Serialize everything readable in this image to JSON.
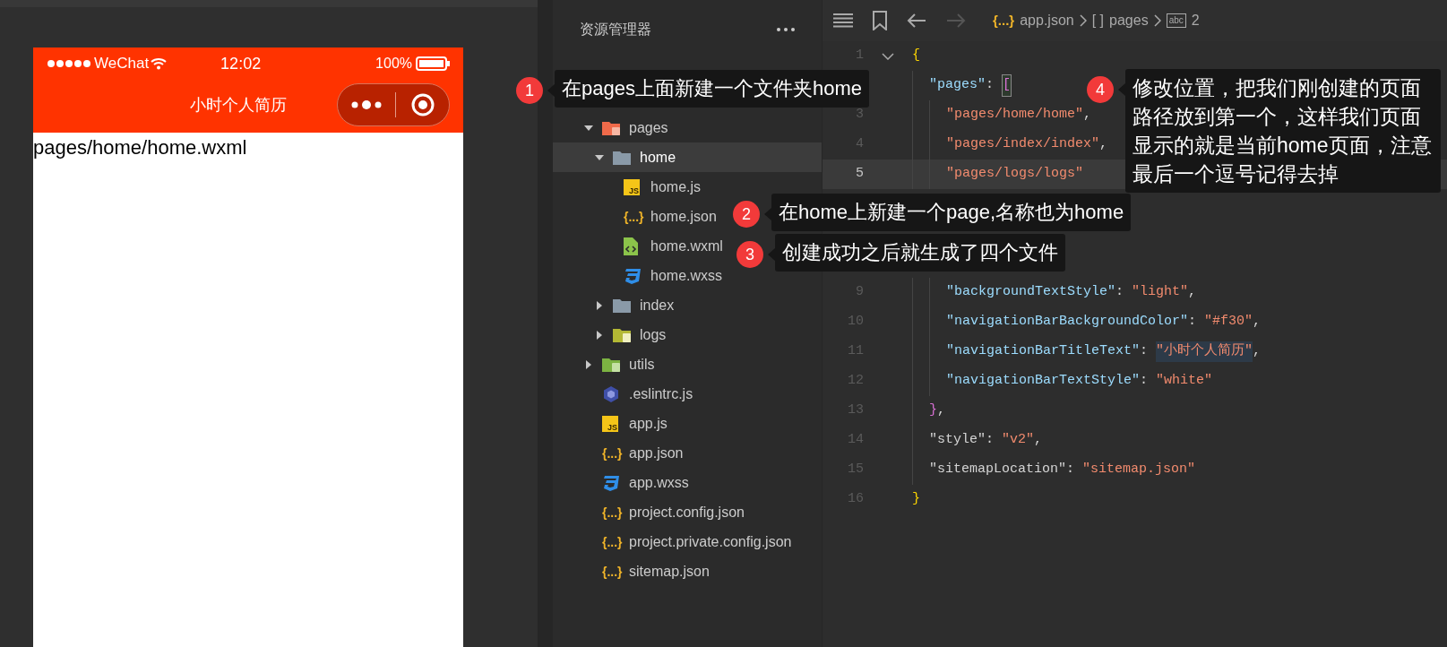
{
  "simulator": {
    "status_bar": {
      "carrier": "WeChat",
      "time": "12:02",
      "battery": "100%"
    },
    "nav_title": "小时个人简历",
    "body_text": "pages/home/home.wxml"
  },
  "explorer": {
    "title": "资源管理器",
    "tree": [
      {
        "name": "pages",
        "kind": "folder_pages",
        "expanded": true,
        "selected": false,
        "children": [
          {
            "name": "home",
            "kind": "folder",
            "expanded": true,
            "selected": true,
            "children": [
              {
                "name": "home.js",
                "kind": "js",
                "glyph": "JS",
                "selected": false
              },
              {
                "name": "home.json",
                "kind": "json",
                "glyph": "{...}",
                "selected": false
              },
              {
                "name": "home.wxml",
                "kind": "wxml",
                "selected": false
              },
              {
                "name": "home.wxss",
                "kind": "wxss",
                "selected": false
              }
            ]
          },
          {
            "name": "index",
            "kind": "folder",
            "expanded": false,
            "selected": false
          },
          {
            "name": "logs",
            "kind": "folder_logs",
            "expanded": false,
            "selected": false
          }
        ]
      },
      {
        "name": "utils",
        "kind": "folder_utils",
        "expanded": false,
        "selected": false
      },
      {
        "name": ".eslintrc.js",
        "kind": "eslint",
        "selected": false
      },
      {
        "name": "app.js",
        "kind": "js",
        "glyph": "JS",
        "selected": false
      },
      {
        "name": "app.json",
        "kind": "json",
        "glyph": "{...}",
        "selected": false
      },
      {
        "name": "app.wxss",
        "kind": "wxss",
        "selected": false
      },
      {
        "name": "project.config.json",
        "kind": "json",
        "glyph": "{...}",
        "selected": false
      },
      {
        "name": "project.private.config.json",
        "kind": "json",
        "glyph": "{...}",
        "selected": false
      },
      {
        "name": "sitemap.json",
        "kind": "json",
        "glyph": "{...}",
        "selected": false
      }
    ]
  },
  "editor": {
    "breadcrumb": [
      {
        "glyph": "{...}",
        "kind": "json",
        "label": "app.json"
      },
      {
        "glyph": "[ ]",
        "kind": "array",
        "label": "pages"
      },
      {
        "glyph": "abc",
        "kind": "string",
        "label": "2"
      }
    ],
    "lines": [
      {
        "number": "1",
        "fold": true,
        "current": false,
        "tokens": [
          {
            "t": "{",
            "kind": "brace"
          }
        ],
        "children": [
          {
            "tokens": [
              {
                "t": "\"pages\"",
                "kind": "key"
              },
              {
                "t": ": ",
                "kind": "punct"
              },
              {
                "t": "[",
                "kind": "bracket"
              }
            ],
            "children": [
              {
                "number": "3",
                "fold": false,
                "current": false,
                "tokens": [
                  {
                    "t": "\"pages/home/home\"",
                    "kind": "string"
                  },
                  {
                    "t": ",",
                    "kind": "punct"
                  }
                ]
              },
              {
                "number": "4",
                "fold": false,
                "current": false,
                "tokens": [
                  {
                    "t": "\"pages/index/index\"",
                    "kind": "string"
                  },
                  {
                    "t": ",",
                    "kind": "punct"
                  }
                ]
              },
              {
                "number": "5",
                "fold": false,
                "current": true,
                "tokens": [
                  {
                    "t": "\"pages/logs/logs\"",
                    "kind": "string"
                  }
                ]
              }
            ]
          },
          {
            "children": [
              {
                "number": "9",
                "fold": false,
                "current": false,
                "tokens": [
                  {
                    "t": "\"backgroundTextStyle\"",
                    "kind": "key"
                  },
                  {
                    "t": ": ",
                    "kind": "punct"
                  },
                  {
                    "t": "\"light\"",
                    "kind": "string"
                  },
                  {
                    "t": ",",
                    "kind": "punct"
                  }
                ]
              },
              {
                "number": "10",
                "fold": false,
                "current": false,
                "tokens": [
                  {
                    "t": "\"navigationBarBackgroundColor\"",
                    "kind": "key"
                  },
                  {
                    "t": ": ",
                    "kind": "punct"
                  },
                  {
                    "t": "\"#f30\"",
                    "kind": "string"
                  },
                  {
                    "t": ",",
                    "kind": "punct"
                  }
                ]
              },
              {
                "number": "11",
                "fold": false,
                "current": false,
                "tokens": [
                  {
                    "t": "\"navigationBarTitleText\"",
                    "kind": "key"
                  },
                  {
                    "t": ": ",
                    "kind": "punct"
                  },
                  {
                    "t": "\"小时个人简历\"",
                    "kind": "string",
                    "selected": true
                  },
                  {
                    "t": ",",
                    "kind": "punct"
                  }
                ]
              },
              {
                "number": "12",
                "fold": false,
                "current": false,
                "tokens": [
                  {
                    "t": "\"navigationBarTextStyle\"",
                    "kind": "key"
                  },
                  {
                    "t": ": ",
                    "kind": "punct"
                  },
                  {
                    "t": "\"white\"",
                    "kind": "string"
                  }
                ]
              }
            ]
          },
          {
            "number": "13",
            "fold": false,
            "current": false,
            "tokens": [
              {
                "t": "}",
                "kind": "brace"
              },
              {
                "t": ",",
                "kind": "punct"
              }
            ]
          },
          {
            "number": "14",
            "fold": false,
            "current": false,
            "tokens": [
              {
                "t": "\"style\"",
                "kind": "plainkey"
              },
              {
                "t": ": ",
                "kind": "punct"
              },
              {
                "t": "\"v2\"",
                "kind": "string"
              },
              {
                "t": ",",
                "kind": "punct"
              }
            ]
          },
          {
            "number": "15",
            "fold": false,
            "current": false,
            "tokens": [
              {
                "t": "\"sitemapLocation\"",
                "kind": "plainkey"
              },
              {
                "t": ": ",
                "kind": "punct"
              },
              {
                "t": "\"sitemap.json\"",
                "kind": "string"
              }
            ]
          }
        ]
      },
      {
        "number": "16",
        "fold": false,
        "current": false,
        "tokens": [
          {
            "t": "}",
            "kind": "brace"
          }
        ]
      }
    ]
  },
  "callouts": [
    {
      "number": "1",
      "text": "在pages上面新建一个文件夹home"
    },
    {
      "number": "2",
      "text": "在home上新建一个page,名称也为home"
    },
    {
      "number": "3",
      "text": "创建成功之后就生成了四个文件"
    },
    {
      "number": "4",
      "text": "修改位置，把我们刚创建的页面路径放到第一个，这样我们页面显示的就是当前home页面，注意最后一个逗号记得去掉"
    }
  ]
}
